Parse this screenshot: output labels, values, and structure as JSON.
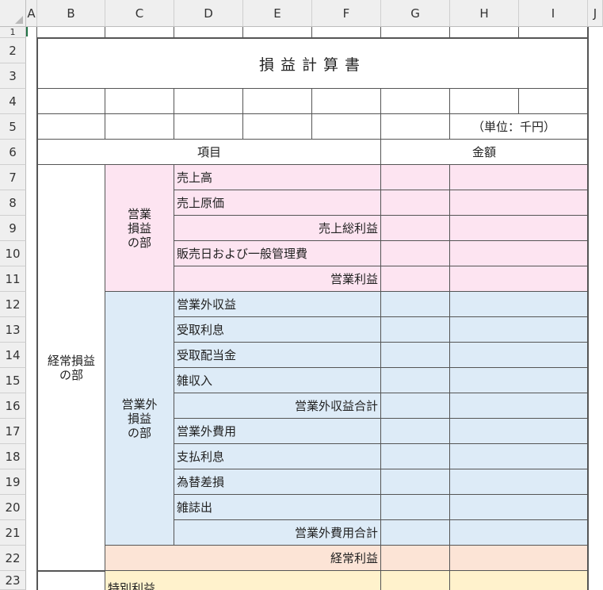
{
  "columns": [
    "A",
    "B",
    "C",
    "D",
    "E",
    "F",
    "G",
    "H",
    "I",
    "J"
  ],
  "rows": [
    "1",
    "2",
    "3",
    "4",
    "5",
    "6",
    "7",
    "8",
    "9",
    "10",
    "11",
    "12",
    "13",
    "14",
    "15",
    "16",
    "17",
    "18",
    "19",
    "20",
    "21",
    "22",
    "23"
  ],
  "sheet": {
    "title": "損益計算書",
    "unit": "（単位：千円）",
    "header_item": "項目",
    "header_amount": "金額",
    "section_ordinary": [
      "経常損益",
      "の部"
    ],
    "section_operating": [
      "営業",
      "損益",
      "の部"
    ],
    "section_nonoperating": [
      "営業外",
      "損益",
      "の部"
    ],
    "items": {
      "r7": "売上高",
      "r8": "売上原価",
      "r9": "売上総利益",
      "r10": "販売日および一般管理費",
      "r11": "営業利益",
      "r12": "営業外収益",
      "r13": "受取利息",
      "r14": "受取配当金",
      "r15": "雑収入",
      "r16": "営業外収益合計",
      "r17": "営業外費用",
      "r18": "支払利息",
      "r19": "為替差損",
      "r20": "雑誌出",
      "r21": "営業外費用合計",
      "r22": "経常利益",
      "r23": "特別利益"
    }
  },
  "colors": {
    "pink": "#fde4f1",
    "blue": "#ddebf7",
    "peach": "#fce4d6",
    "yellow": "#fff2cc",
    "header_bg": "#efefef"
  }
}
